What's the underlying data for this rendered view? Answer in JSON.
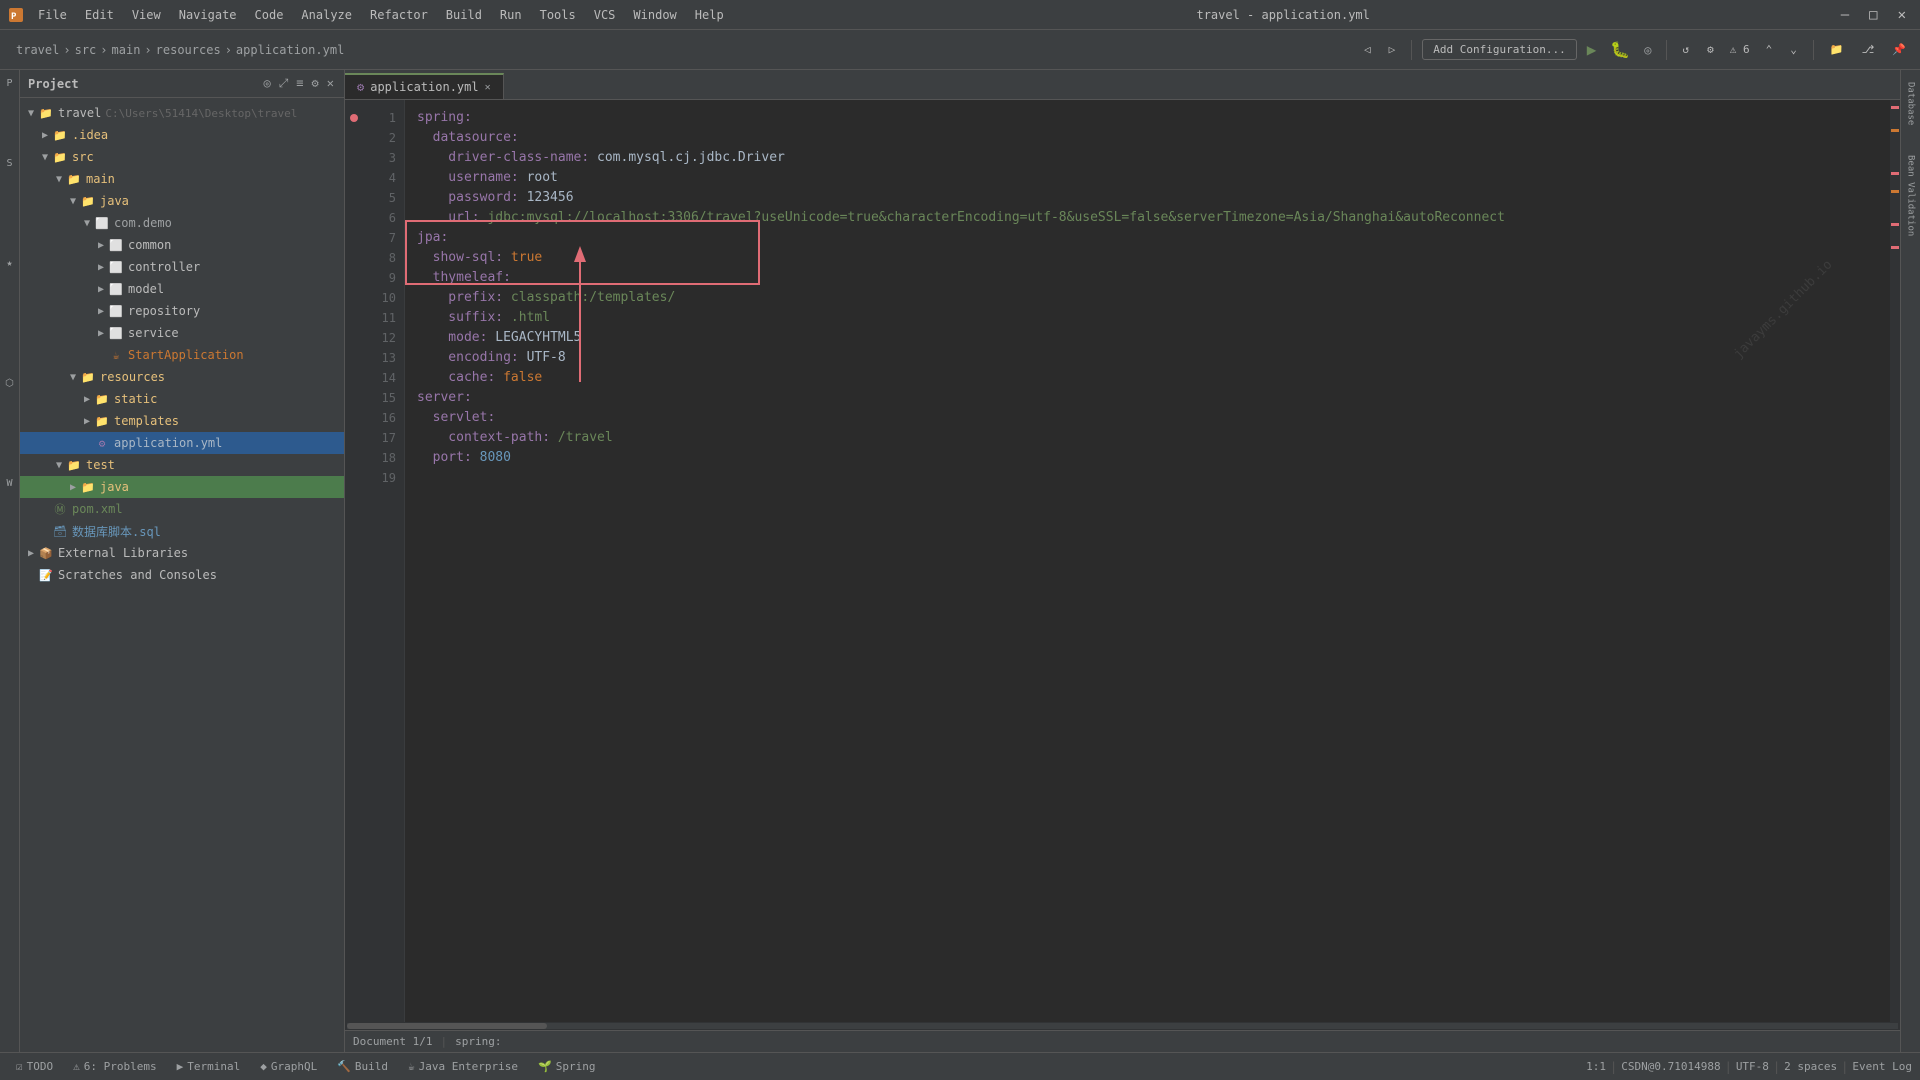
{
  "titleBar": {
    "title": "travel - application.yml",
    "menus": [
      "File",
      "Edit",
      "View",
      "Navigate",
      "Code",
      "Analyze",
      "Refactor",
      "Build",
      "Run",
      "Tools",
      "VCS",
      "Window",
      "Help"
    ],
    "appName": "travel",
    "minimize": "—",
    "maximize": "□",
    "close": "✕"
  },
  "breadcrumb": {
    "parts": [
      "travel",
      "src",
      "main",
      "resources",
      "application.yml"
    ]
  },
  "toolbar": {
    "runConfig": "Add Configuration...",
    "buttons": [
      "Project",
      "Structure",
      "Favorites",
      "Persistence",
      "Web"
    ]
  },
  "projectPanel": {
    "title": "Project",
    "root": {
      "label": "travel",
      "path": "C:\\Users\\51414\\Desktop\\travel"
    },
    "tree": [
      {
        "level": 0,
        "type": "folder",
        "name": "travel",
        "meta": "C:\\Users\\51414\\Desktop\\travel",
        "expanded": true
      },
      {
        "level": 1,
        "type": "folder",
        "name": ".idea",
        "expanded": false
      },
      {
        "level": 1,
        "type": "folder",
        "name": "src",
        "expanded": true
      },
      {
        "level": 2,
        "type": "folder",
        "name": "main",
        "expanded": true
      },
      {
        "level": 3,
        "type": "folder",
        "name": "java",
        "expanded": true
      },
      {
        "level": 4,
        "type": "package",
        "name": "com.demo",
        "expanded": true
      },
      {
        "level": 5,
        "type": "folder",
        "name": "common",
        "expanded": false
      },
      {
        "level": 5,
        "type": "folder",
        "name": "controller",
        "expanded": false
      },
      {
        "level": 5,
        "type": "folder",
        "name": "model",
        "expanded": false
      },
      {
        "level": 5,
        "type": "folder",
        "name": "repository",
        "expanded": false
      },
      {
        "level": 5,
        "type": "folder",
        "name": "service",
        "expanded": false
      },
      {
        "level": 5,
        "type": "java",
        "name": "StartApplication"
      },
      {
        "level": 3,
        "type": "folder",
        "name": "resources",
        "expanded": true
      },
      {
        "level": 4,
        "type": "folder",
        "name": "static",
        "expanded": false
      },
      {
        "level": 4,
        "type": "folder",
        "name": "templates",
        "expanded": false
      },
      {
        "level": 4,
        "type": "yaml",
        "name": "application.yml",
        "selected": true
      },
      {
        "level": 2,
        "type": "folder",
        "name": "test",
        "expanded": true
      },
      {
        "level": 3,
        "type": "folder",
        "name": "java",
        "expanded": false
      },
      {
        "level": 0,
        "type": "xml",
        "name": "pom.xml"
      },
      {
        "level": 0,
        "type": "sql",
        "name": "数据库脚本.sql"
      },
      {
        "level": 0,
        "type": "node",
        "name": "External Libraries",
        "expanded": false
      },
      {
        "level": 0,
        "type": "node",
        "name": "Scratches and Consoles"
      }
    ]
  },
  "tab": {
    "label": "application.yml",
    "active": true
  },
  "editor": {
    "lines": [
      {
        "num": 1,
        "content": [
          {
            "t": "spring:",
            "c": "key"
          }
        ]
      },
      {
        "num": 2,
        "content": [
          {
            "t": "  datasource:",
            "c": "key"
          }
        ]
      },
      {
        "num": 3,
        "content": [
          {
            "t": "    driver-class-name: ",
            "c": "key"
          },
          {
            "t": "com.mysql.cj.jdbc.Driver",
            "c": "val"
          }
        ]
      },
      {
        "num": 4,
        "content": [
          {
            "t": "    username: ",
            "c": "key"
          },
          {
            "t": "root",
            "c": "val"
          }
        ]
      },
      {
        "num": 5,
        "content": [
          {
            "t": "    password: ",
            "c": "key"
          },
          {
            "t": "123456",
            "c": "val"
          }
        ]
      },
      {
        "num": 6,
        "content": [
          {
            "t": "    url: ",
            "c": "key"
          },
          {
            "t": "jdbc:mysql://localhost:3306/travel?useUnicode=true&characterEncoding=utf-8&useSSL=false&serverTimezone=Asia/Shanghai&autoReconnect",
            "c": "str"
          }
        ]
      },
      {
        "num": 7,
        "content": [
          {
            "t": "jpa:",
            "c": "key"
          }
        ]
      },
      {
        "num": 8,
        "content": [
          {
            "t": "  show-sql: ",
            "c": "key"
          },
          {
            "t": "true",
            "c": "val-orange"
          }
        ]
      },
      {
        "num": 9,
        "content": [
          {
            "t": "  thymeleaf:",
            "c": "key"
          }
        ]
      },
      {
        "num": 10,
        "content": [
          {
            "t": "    prefix: ",
            "c": "key"
          },
          {
            "t": "classpath:/templates/",
            "c": "str"
          }
        ]
      },
      {
        "num": 11,
        "content": [
          {
            "t": "    suffix: ",
            "c": "key"
          },
          {
            "t": ".html",
            "c": "str"
          }
        ]
      },
      {
        "num": 12,
        "content": [
          {
            "t": "    mode: ",
            "c": "key"
          },
          {
            "t": "LEGACYHTML5",
            "c": "val"
          }
        ]
      },
      {
        "num": 13,
        "content": [
          {
            "t": "    encoding: ",
            "c": "key"
          },
          {
            "t": "UTF-8",
            "c": "val"
          }
        ]
      },
      {
        "num": 14,
        "content": [
          {
            "t": "    cache: ",
            "c": "key"
          },
          {
            "t": "false",
            "c": "val-orange"
          }
        ]
      },
      {
        "num": 15,
        "content": [
          {
            "t": "server:",
            "c": "key"
          }
        ]
      },
      {
        "num": 16,
        "content": [
          {
            "t": "  servlet:",
            "c": "key"
          }
        ]
      },
      {
        "num": 17,
        "content": [
          {
            "t": "    context-path: ",
            "c": "key"
          },
          {
            "t": "/travel",
            "c": "str"
          }
        ]
      },
      {
        "num": 18,
        "content": [
          {
            "t": "  port: ",
            "c": "key"
          },
          {
            "t": "8080",
            "c": "num"
          }
        ]
      },
      {
        "num": 19,
        "content": []
      }
    ]
  },
  "statusBar": {
    "docInfo": "Document 1/1",
    "cursor": "spring:",
    "position": "1:1",
    "encoding": "UTF-8",
    "lineSep": "2 spaces",
    "branchInfo": "CSDN@0.71014988"
  },
  "bottomBar": {
    "items": [
      "TODO",
      "6: Problems",
      "Terminal",
      "GraphQL",
      "Build",
      "Java Enterprise",
      "Spring"
    ]
  },
  "errors": {
    "count": "6",
    "label": "⚠ 6"
  },
  "watermark": "javayms.github.io"
}
